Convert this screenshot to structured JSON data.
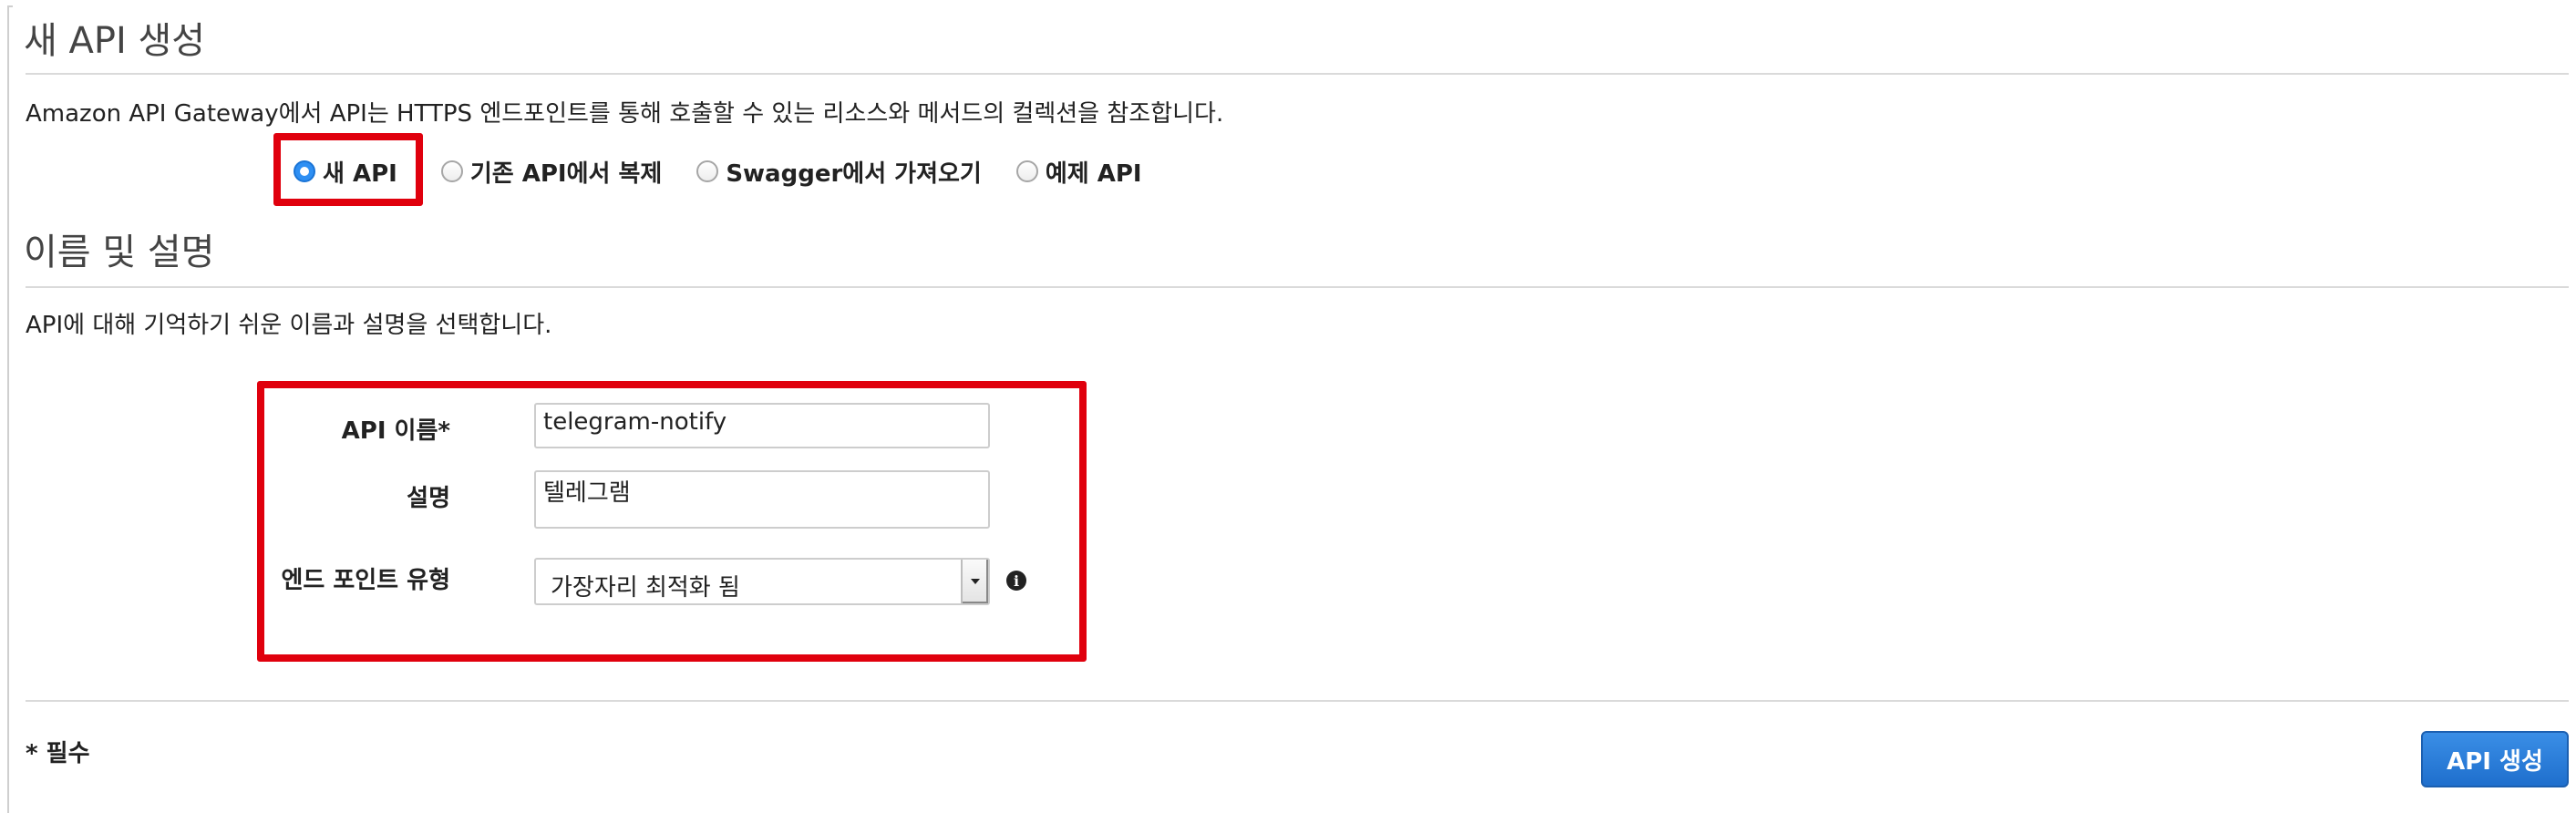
{
  "header": {
    "title": "새 API 생성",
    "description": "Amazon API Gateway에서 API는 HTTPS 엔드포인트를 통해 호출할 수 있는 리소스와 메서드의 컬렉션을 참조합니다."
  },
  "api_type": {
    "options": [
      {
        "label": "새 API",
        "selected": true
      },
      {
        "label": "기존 API에서 복제",
        "selected": false
      },
      {
        "label": "Swagger에서 가져오기",
        "selected": false
      },
      {
        "label": "예제 API",
        "selected": false
      }
    ]
  },
  "name_section": {
    "title": "이름 및 설명",
    "description": "API에 대해 기억하기 쉬운 이름과 설명을 선택합니다."
  },
  "form": {
    "api_name_label": "API 이름*",
    "api_name_value": "telegram-notify",
    "description_label": "설명",
    "description_value": "텔레그램",
    "endpoint_type_label": "엔드 포인트 유형",
    "endpoint_type_value": "가장자리 최적화 됨"
  },
  "footer": {
    "required_note": "* 필수",
    "create_button_label": "API 생성"
  },
  "colors": {
    "highlight_border": "#e0000d",
    "primary_button": "#2575d8",
    "radio_selected": "#2e8ff3"
  },
  "icons": {
    "info": "info-circle-icon",
    "select_arrow": "caret-down-icon"
  }
}
